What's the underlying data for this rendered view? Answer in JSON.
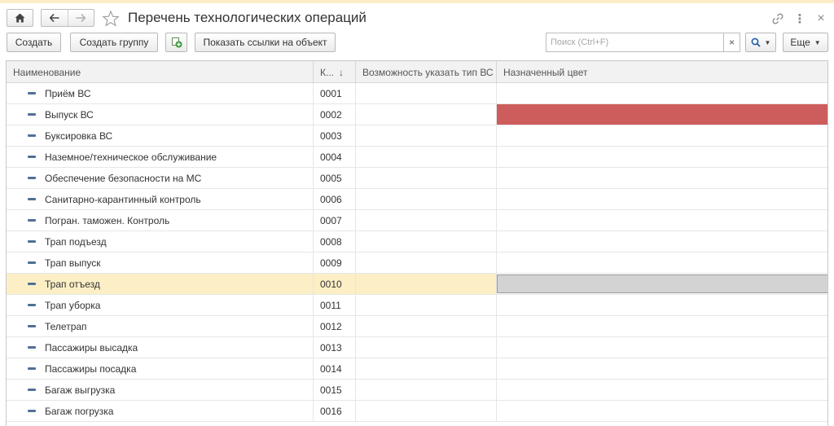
{
  "window": {
    "title": "Перечень технологических операций"
  },
  "icons": {
    "home": "home-icon",
    "back": "arrow-left-icon",
    "forward": "arrow-right-icon",
    "favorite": "star-icon",
    "link": "link-icon",
    "more": "more-vert-icon",
    "close": "close-icon",
    "copy": "copy-add-icon",
    "search": "search-icon",
    "row_item": "item-dash-icon"
  },
  "toolbar": {
    "create_label": "Создать",
    "create_group_label": "Создать группу",
    "show_links_label": "Показать ссылки на объект",
    "more_label": "Еще"
  },
  "search": {
    "placeholder": "Поиск (Ctrl+F)",
    "value": "",
    "clear": "×"
  },
  "table": {
    "columns": {
      "name": "Наименование",
      "code": "К...",
      "vs_type": "Возможность указать тип ВС",
      "color": "Назначенный цвет"
    },
    "sort": "↓",
    "rows": [
      {
        "name": "Приём ВС",
        "code": "0001",
        "color": ""
      },
      {
        "name": "Выпуск ВС",
        "code": "0002",
        "color": "#cd5c5c"
      },
      {
        "name": "Буксировка ВС",
        "code": "0003",
        "color": ""
      },
      {
        "name": "Наземное/техническое обслуживание",
        "code": "0004",
        "color": ""
      },
      {
        "name": "Обеспечение безопасности на МС",
        "code": "0005",
        "color": ""
      },
      {
        "name": "Санитарно-карантинный контроль",
        "code": "0006",
        "color": ""
      },
      {
        "name": "Погран. таможен. Контроль",
        "code": "0007",
        "color": ""
      },
      {
        "name": "Трап подъезд",
        "code": "0008",
        "color": ""
      },
      {
        "name": "Трап выпуск",
        "code": "0009",
        "color": ""
      },
      {
        "name": "Трап отъезд",
        "code": "0010",
        "color": "#d3d3d3",
        "selected": true
      },
      {
        "name": "Трап уборка",
        "code": "0011",
        "color": ""
      },
      {
        "name": "Телетрап",
        "code": "0012",
        "color": ""
      },
      {
        "name": "Пассажиры высадка",
        "code": "0013",
        "color": ""
      },
      {
        "name": "Пассажиры посадка",
        "code": "0014",
        "color": ""
      },
      {
        "name": "Багаж выгрузка",
        "code": "0015",
        "color": ""
      },
      {
        "name": "Багаж погрузка",
        "code": "0016",
        "color": ""
      }
    ]
  },
  "colors": {
    "selected_row": "#fcefc6",
    "accent_red": "#cd5c5c"
  }
}
